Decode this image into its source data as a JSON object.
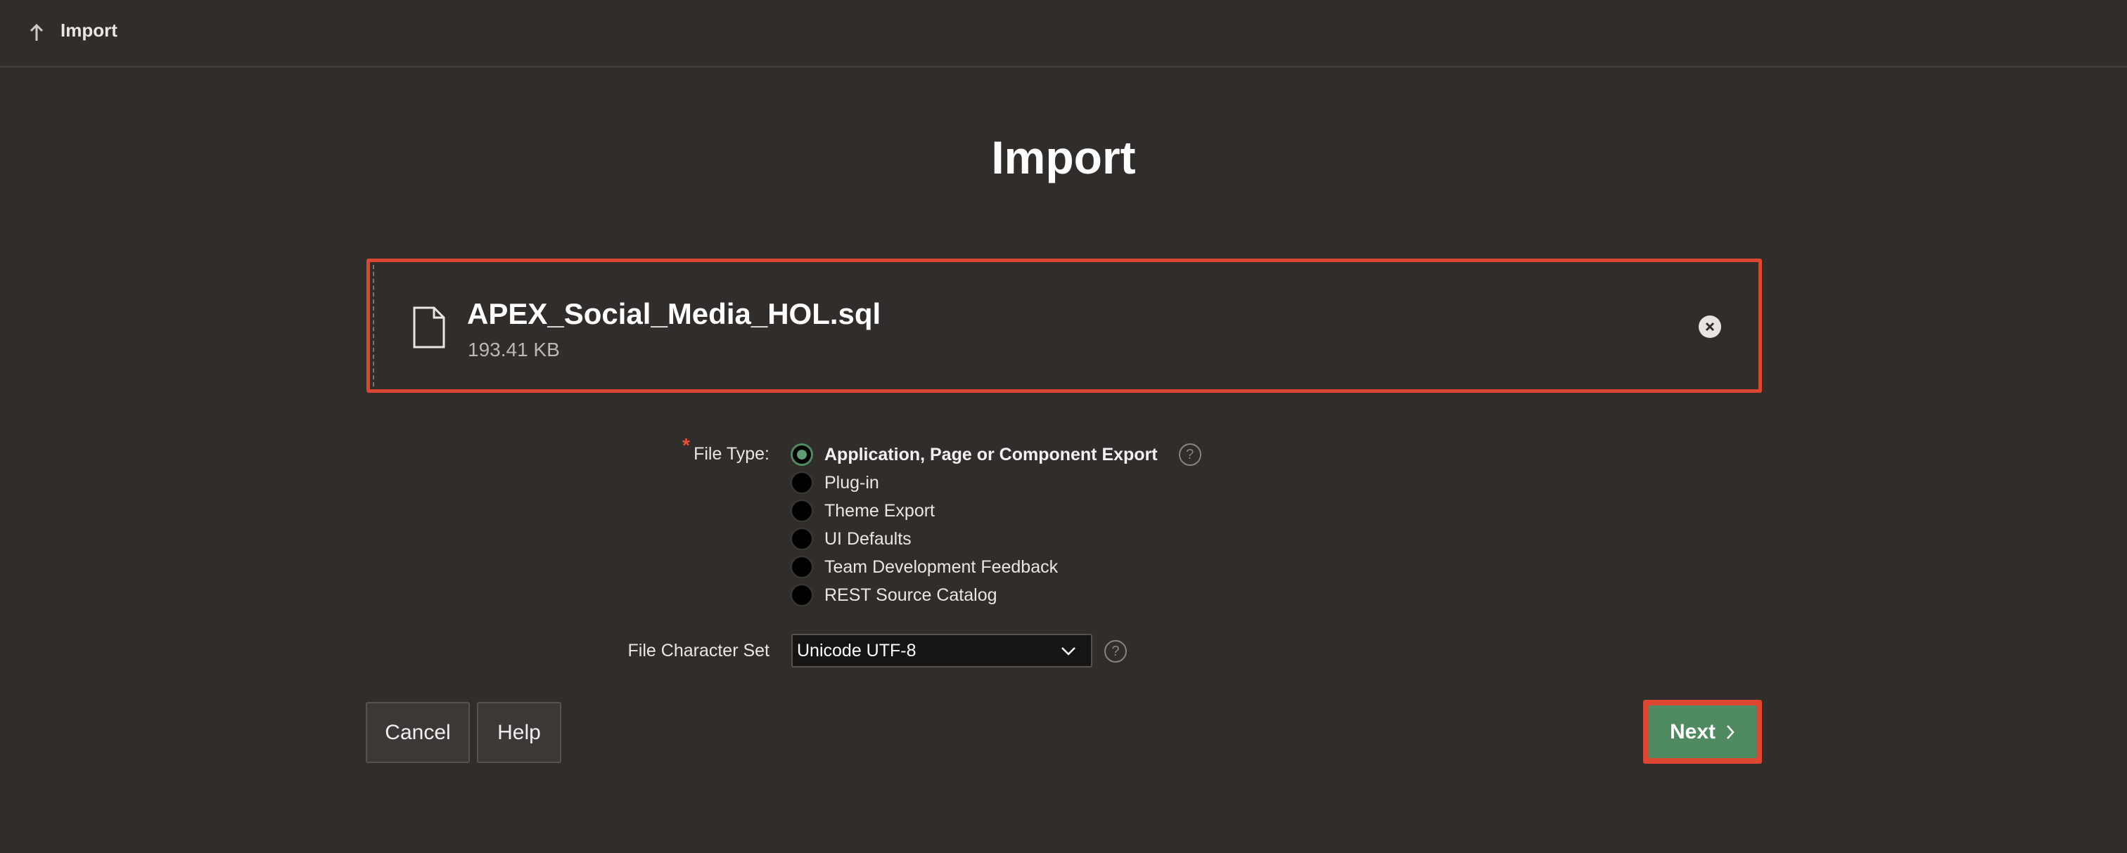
{
  "topbar": {
    "breadcrumb": "Import",
    "icon": "arrow-up-icon"
  },
  "page": {
    "title": "Import"
  },
  "file": {
    "name": "APEX_Social_Media_HOL.sql",
    "size": "193.41 KB",
    "icon": "file-icon",
    "remove_icon": "close-circle-icon"
  },
  "file_type": {
    "label": "File Type:",
    "required_marker": "*",
    "options": [
      {
        "label": "Application, Page or Component Export",
        "selected": true
      },
      {
        "label": "Plug-in",
        "selected": false
      },
      {
        "label": "Theme Export",
        "selected": false
      },
      {
        "label": "UI Defaults",
        "selected": false
      },
      {
        "label": "Team Development Feedback",
        "selected": false
      },
      {
        "label": "REST Source Catalog",
        "selected": false
      }
    ],
    "help_glyph": "?"
  },
  "charset": {
    "label": "File Character Set",
    "value": "Unicode UTF-8",
    "help_glyph": "?"
  },
  "buttons": {
    "cancel": "Cancel",
    "help": "Help",
    "next": "Next"
  },
  "colors": {
    "background": "#312d2a",
    "highlight_border": "#dd4631",
    "primary_button": "#4f8a61",
    "required": "#e8503a"
  }
}
